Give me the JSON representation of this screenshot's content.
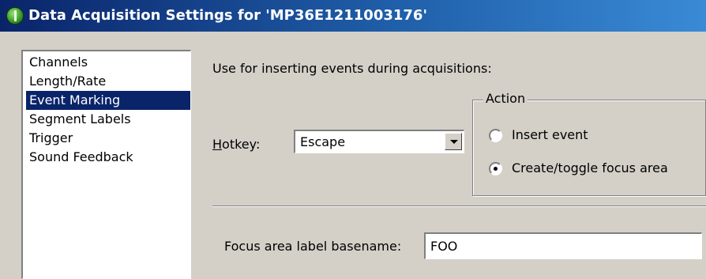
{
  "window": {
    "title": "Data Acquisition Settings for 'MP36E1211003176'",
    "icon": "biopac-app-icon"
  },
  "sidebar": {
    "items": [
      {
        "label": "Channels",
        "selected": false
      },
      {
        "label": "Length/Rate",
        "selected": false
      },
      {
        "label": "Event Marking",
        "selected": true
      },
      {
        "label": "Segment Labels",
        "selected": false
      },
      {
        "label": "Trigger",
        "selected": false
      },
      {
        "label": "Sound Feedback",
        "selected": false
      }
    ]
  },
  "panel": {
    "intro": "Use for inserting events during acquisitions:",
    "hotkey": {
      "label_mnemonic": "H",
      "label_rest": "otkey:",
      "value": "Escape"
    },
    "action": {
      "legend": "Action",
      "options": [
        {
          "label": "Insert event",
          "checked": false
        },
        {
          "label": "Create/toggle focus area",
          "checked": true
        }
      ]
    },
    "basename": {
      "label": "Focus area label basename:",
      "value": "FOO"
    }
  },
  "colors": {
    "titlebar": "#0a246a",
    "selection": "#0a246a",
    "face": "#d4d0c8"
  }
}
